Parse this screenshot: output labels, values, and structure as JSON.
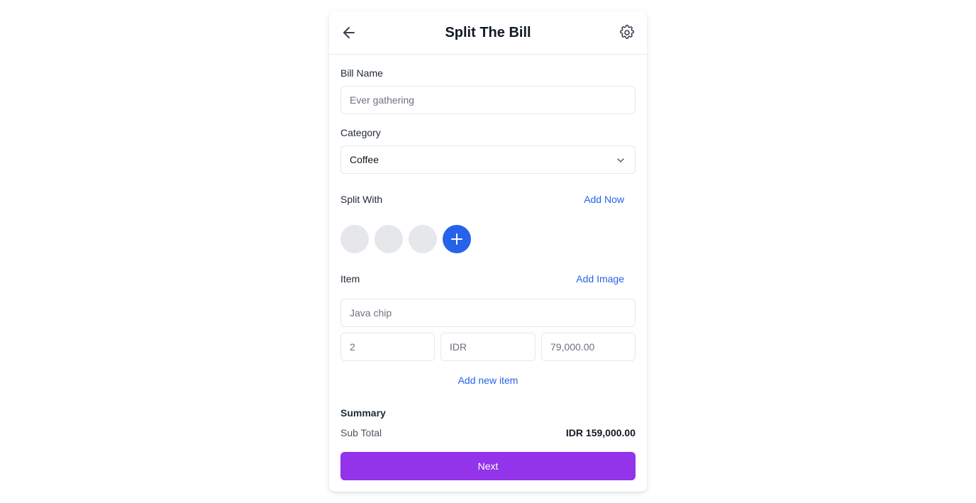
{
  "header": {
    "title": "Split The Bill",
    "back_icon": "arrow-left-icon",
    "settings_icon": "gear-icon"
  },
  "bill_name": {
    "label": "Bill Name",
    "placeholder": "Ever gathering",
    "value": ""
  },
  "category": {
    "label": "Category",
    "selected": "Coffee",
    "icon": "chevron-down-icon"
  },
  "split_with": {
    "label": "Split With",
    "action": "Add Now",
    "avatar_count": 3,
    "add_icon": "plus-icon"
  },
  "item": {
    "label": "Item",
    "action": "Add Image",
    "name_placeholder": "Java chip",
    "quantity_placeholder": "2",
    "currency_placeholder": "IDR",
    "price_placeholder": "79,000.00",
    "add_new": "Add new item"
  },
  "summary": {
    "label": "Summary",
    "subtotal_label": "Sub Total",
    "subtotal_value": "IDR 159,000.00"
  },
  "footer": {
    "next_label": "Next"
  },
  "colors": {
    "accent_blue": "#2563eb",
    "primary_purple": "#9333ea",
    "border": "#e5e7eb"
  }
}
